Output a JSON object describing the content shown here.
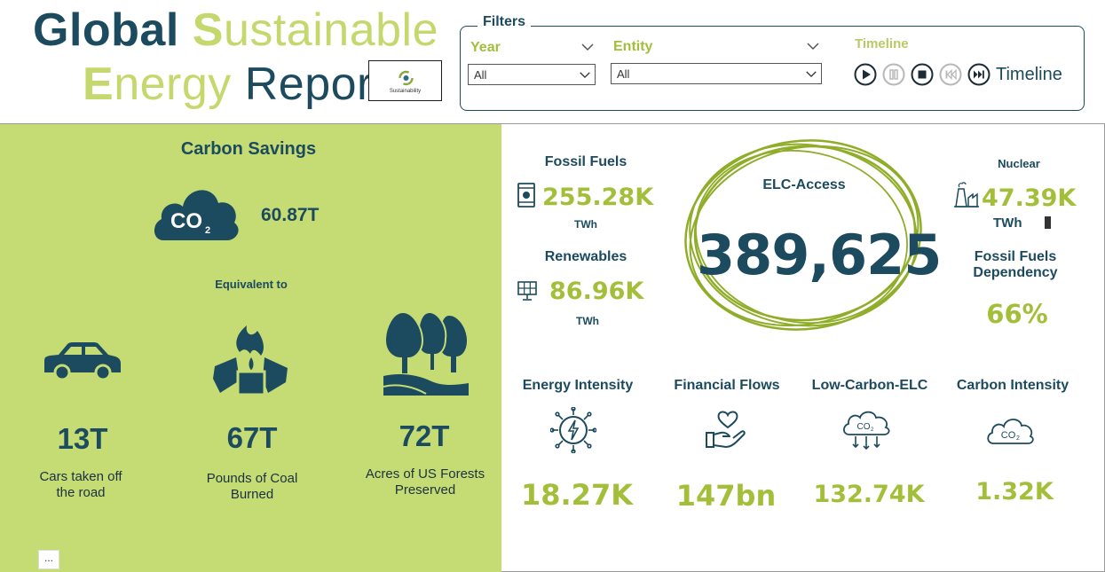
{
  "title": {
    "line1_part1": "Global",
    "line1_part2_initial": "S",
    "line1_part2_rest": "ustainable",
    "line2_part1_initial": "E",
    "line2_part1_rest": "nergy",
    "line2_part2": "Report"
  },
  "logo": {
    "text": "Sustainability"
  },
  "filters": {
    "legend": "Filters",
    "year": {
      "label": "Year",
      "value": "All"
    },
    "entity": {
      "label": "Entity",
      "value": "All"
    },
    "timeline": {
      "label": "Timeline",
      "text": "Timeline"
    }
  },
  "carbon": {
    "title": "Carbon Savings",
    "co2_label": "CO",
    "co2_sub": "2",
    "value": "60.87T",
    "equivalent": "Equivalent to",
    "cars": {
      "value": "13T",
      "label_line1": "Cars taken off",
      "label_line2": "the road"
    },
    "coal": {
      "value": "67T",
      "label_line1": "Pounds of Coal",
      "label_line2": "Burned"
    },
    "forests": {
      "value": "72T",
      "label_line1": "Acres of US Forests",
      "label_line2": "Preserved"
    }
  },
  "fossil": {
    "title": "Fossil Fuels",
    "value": "255.28K",
    "unit": "TWh"
  },
  "renewables": {
    "title": "Renewables",
    "value": "86.96K",
    "unit": "TWh"
  },
  "elc_access": {
    "title": "ELC-Access",
    "value": "389,625"
  },
  "nuclear": {
    "title": "Nuclear",
    "value": "47.39K",
    "unit": "TWh"
  },
  "dependency": {
    "title_line1": "Fossil Fuels",
    "title_line2": "Dependency",
    "value": "66%"
  },
  "bottom": {
    "energy_intensity": {
      "title": "Energy Intensity",
      "value": "18.27K"
    },
    "financial_flows": {
      "title": "Financial Flows",
      "value": "147bn"
    },
    "low_carbon": {
      "title": "Low-Carbon-ELC",
      "value": "132.74K",
      "icon_text": "CO",
      "icon_sub": "2"
    },
    "carbon_intensity": {
      "title": "Carbon Intensity",
      "value": "1.32K",
      "icon_text": "CO",
      "icon_sub": "2"
    }
  },
  "more_options": "..."
}
